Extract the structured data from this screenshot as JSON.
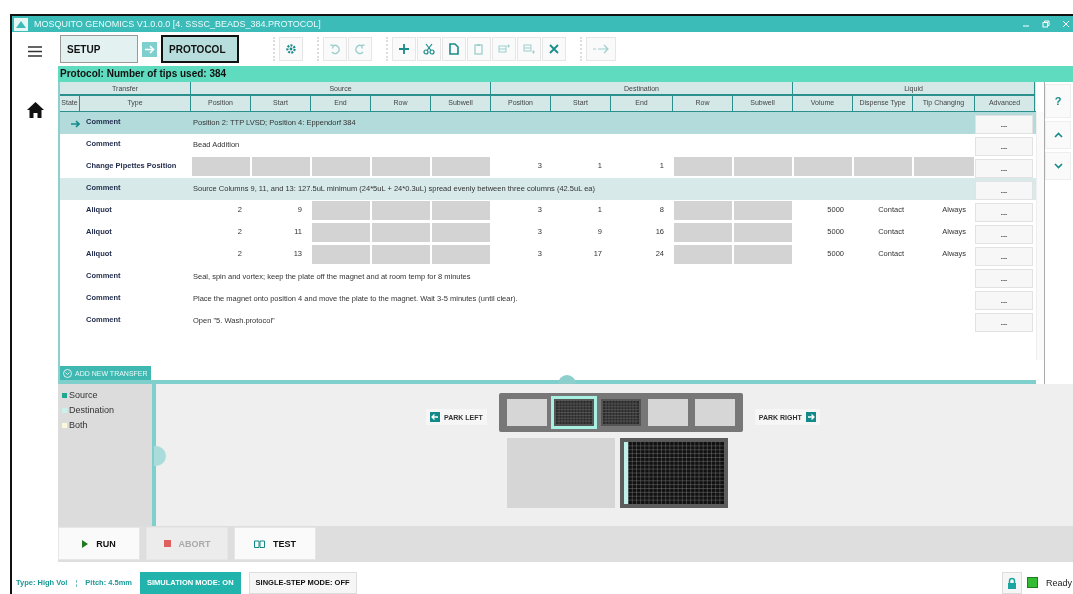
{
  "window": {
    "title": "MOSQUITO GENOMICS V1.0.0.0 [4. SSSC_BEADS_384.PROTOCOL]"
  },
  "breadcrumb": [
    {
      "label": "SETUP",
      "selected": false
    },
    {
      "label": "PROTOCOL",
      "selected": true
    }
  ],
  "toolbar": [
    [
      {
        "kind": "settings",
        "disabled": false
      }
    ],
    [
      {
        "kind": "undo",
        "disabled": true
      },
      {
        "kind": "redo",
        "disabled": true
      }
    ],
    [
      {
        "kind": "add",
        "disabled": false
      },
      {
        "kind": "cut",
        "disabled": false
      },
      {
        "kind": "copy",
        "disabled": false
      },
      {
        "kind": "paste",
        "disabled": true
      },
      {
        "kind": "insert-above",
        "disabled": true
      },
      {
        "kind": "insert-below",
        "disabled": true
      },
      {
        "kind": "delete",
        "disabled": false
      }
    ],
    [
      {
        "kind": "run-to",
        "disabled": true
      }
    ]
  ],
  "protocol_header": "Protocol: Number of tips used: 384",
  "table": {
    "groups": [
      {
        "label": "Transfer",
        "columns": [
          "State",
          "Type"
        ]
      },
      {
        "label": "Source",
        "columns": [
          "Position",
          "Start",
          "End",
          "Row",
          "Subwell"
        ]
      },
      {
        "label": "Destination",
        "columns": [
          "Position",
          "Start",
          "End",
          "Row",
          "Subwell"
        ]
      },
      {
        "label": "Liquid",
        "columns": [
          "Volume",
          "Dispense Type",
          "Tip Changing",
          "Advanced"
        ]
      }
    ],
    "rows": [
      {
        "type": "Comment",
        "kind": "comment",
        "selected": true,
        "highlighted": false,
        "text": "Position 2: TTP LVSD; Position 4: Eppendorf 384",
        "advanced": "..."
      },
      {
        "type": "Comment",
        "kind": "comment",
        "selected": false,
        "highlighted": false,
        "text": "Bead Addition",
        "advanced": "..."
      },
      {
        "type": "Change Pipettes Position",
        "kind": "cells",
        "selected": false,
        "highlighted": false,
        "advanced": "...",
        "cells": [
          {
            "kind": "blocked"
          },
          {
            "kind": "blocked"
          },
          {
            "kind": "blocked"
          },
          {
            "kind": "blocked"
          },
          {
            "kind": "blocked"
          },
          {
            "kind": "value",
            "text": "3"
          },
          {
            "kind": "value",
            "text": "1"
          },
          {
            "kind": "value",
            "text": "1"
          },
          {
            "kind": "blocked"
          },
          {
            "kind": "blocked"
          },
          {
            "kind": "blocked"
          },
          {
            "kind": "blocked"
          },
          {
            "kind": "blocked"
          }
        ]
      },
      {
        "type": "Comment",
        "kind": "comment",
        "selected": false,
        "highlighted": true,
        "text": "Source Columns 9, 11, and 13: 127.5uL minimum (24*5uL + 24*0.3uL) spread evenly between three columns (42.5uL ea)",
        "advanced": "..."
      },
      {
        "type": "Aliquot",
        "kind": "cells",
        "selected": false,
        "highlighted": false,
        "advanced": "...",
        "cells": [
          {
            "kind": "value",
            "text": "2"
          },
          {
            "kind": "value",
            "text": "9"
          },
          {
            "kind": "blocked"
          },
          {
            "kind": "blocked"
          },
          {
            "kind": "blocked"
          },
          {
            "kind": "value",
            "text": "3"
          },
          {
            "kind": "value",
            "text": "1"
          },
          {
            "kind": "value",
            "text": "8"
          },
          {
            "kind": "blocked"
          },
          {
            "kind": "blocked"
          },
          {
            "kind": "value",
            "text": "5000"
          },
          {
            "kind": "value",
            "text": "Contact"
          },
          {
            "kind": "value",
            "text": "Always"
          }
        ]
      },
      {
        "type": "Aliquot",
        "kind": "cells",
        "selected": false,
        "highlighted": false,
        "advanced": "...",
        "cells": [
          {
            "kind": "value",
            "text": "2"
          },
          {
            "kind": "value",
            "text": "11"
          },
          {
            "kind": "blocked"
          },
          {
            "kind": "blocked"
          },
          {
            "kind": "blocked"
          },
          {
            "kind": "value",
            "text": "3"
          },
          {
            "kind": "value",
            "text": "9"
          },
          {
            "kind": "value",
            "text": "16"
          },
          {
            "kind": "blocked"
          },
          {
            "kind": "blocked"
          },
          {
            "kind": "value",
            "text": "5000"
          },
          {
            "kind": "value",
            "text": "Contact"
          },
          {
            "kind": "value",
            "text": "Always"
          }
        ]
      },
      {
        "type": "Aliquot",
        "kind": "cells",
        "selected": false,
        "highlighted": false,
        "advanced": "...",
        "cells": [
          {
            "kind": "value",
            "text": "2"
          },
          {
            "kind": "value",
            "text": "13"
          },
          {
            "kind": "blocked"
          },
          {
            "kind": "blocked"
          },
          {
            "kind": "blocked"
          },
          {
            "kind": "value",
            "text": "3"
          },
          {
            "kind": "value",
            "text": "17"
          },
          {
            "kind": "value",
            "text": "24"
          },
          {
            "kind": "blocked"
          },
          {
            "kind": "blocked"
          },
          {
            "kind": "value",
            "text": "5000"
          },
          {
            "kind": "value",
            "text": "Contact"
          },
          {
            "kind": "value",
            "text": "Always"
          }
        ]
      },
      {
        "type": "Comment",
        "kind": "comment",
        "selected": false,
        "highlighted": false,
        "text": "Seal, spin and vortex; keep the plate off the magnet and at room temp for 8 minutes",
        "advanced": "..."
      },
      {
        "type": "Comment",
        "kind": "comment",
        "selected": false,
        "highlighted": false,
        "text": "Place the magnet onto position 4 and move the plate to the magnet. Wait 3-5 minutes (until clear).",
        "advanced": "..."
      },
      {
        "type": "Comment",
        "kind": "comment",
        "selected": false,
        "highlighted": false,
        "text": "Open \"5. Wash.protocol\"",
        "advanced": "..."
      }
    ]
  },
  "side_buttons": [
    {
      "kind": "help",
      "label": "?"
    },
    {
      "kind": "up"
    },
    {
      "kind": "down"
    }
  ],
  "add_transfer": "ADD NEW TRANSFER",
  "legend": [
    {
      "label": "Source",
      "color": "#1fa88f"
    },
    {
      "label": "Destination",
      "color": "#c8f2ea"
    },
    {
      "label": "Both",
      "color": "#fbf8dc"
    }
  ],
  "deck": {
    "park_left": "PARK LEFT",
    "park_right": "PARK RIGHT",
    "slots": [
      {
        "kind": "empty",
        "selected": false
      },
      {
        "kind": "plate",
        "selected": true
      },
      {
        "kind": "plate",
        "selected": false
      },
      {
        "kind": "empty",
        "selected": false
      },
      {
        "kind": "empty",
        "selected": false
      }
    ],
    "stations": [
      {
        "kind": "empty"
      },
      {
        "kind": "plate-384"
      }
    ]
  },
  "actions": [
    {
      "kind": "run",
      "label": "RUN",
      "disabled": false
    },
    {
      "kind": "abort",
      "label": "ABORT",
      "disabled": true
    },
    {
      "kind": "test",
      "label": "TEST",
      "disabled": false
    }
  ],
  "status_bar": {
    "type": "Type: High Vol",
    "separator": "¦",
    "pitch": "Pitch: 4.5mm",
    "modes": [
      {
        "label": "SIMULATION MODE: ON",
        "on": true
      },
      {
        "label": "SINGLE-STEP MODE: OFF",
        "on": false
      }
    ],
    "locked": true,
    "status": "Ready"
  }
}
